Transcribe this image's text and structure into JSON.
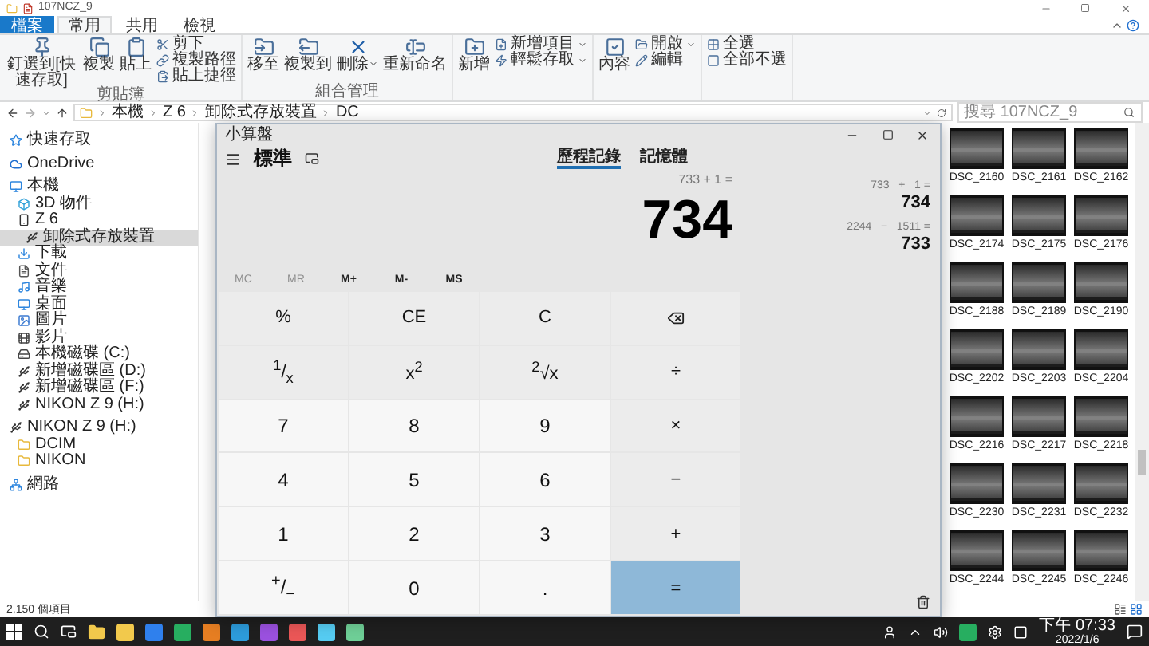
{
  "explorer": {
    "title": "107NCZ_9",
    "ribbon_tabs": [
      {
        "label": "檔案",
        "kind": "file",
        "selected": false
      },
      {
        "label": "常用",
        "kind": "tab",
        "selected": true
      },
      {
        "label": "共用",
        "kind": "tab",
        "selected": false
      },
      {
        "label": "檢視",
        "kind": "tab",
        "selected": false
      }
    ],
    "ribbon_groups": [
      {
        "label": "剪貼簿",
        "items": [
          {
            "kind": "large",
            "label": "釘選到[快速存取]"
          },
          {
            "kind": "large",
            "label": "複製"
          },
          {
            "kind": "large",
            "label": "貼上"
          },
          {
            "kind": "stack",
            "items": [
              {
                "label": "剪下"
              },
              {
                "label": "複製路徑"
              },
              {
                "label": "貼上捷徑"
              }
            ]
          }
        ]
      },
      {
        "label": "組合管理",
        "items": [
          {
            "kind": "large",
            "label": "移至"
          },
          {
            "kind": "large",
            "label": "複製到"
          },
          {
            "kind": "large",
            "label": "刪除",
            "dropdown": true
          },
          {
            "kind": "large",
            "label": "重新命名"
          }
        ]
      },
      {
        "items": [
          {
            "kind": "large",
            "label": "新增"
          },
          {
            "kind": "stack",
            "items": [
              {
                "label": "新增項目",
                "dropdown": true
              },
              {
                "label": "輕鬆存取",
                "dropdown": true
              }
            ]
          }
        ]
      },
      {
        "items": [
          {
            "kind": "large",
            "label": "內容"
          },
          {
            "kind": "stack",
            "items": [
              {
                "label": "開啟",
                "dropdown": true
              },
              {
                "label": "編輯"
              }
            ]
          }
        ]
      },
      {
        "items": [
          {
            "kind": "stack",
            "items": [
              {
                "label": "全選"
              },
              {
                "label": "全部不選"
              }
            ]
          }
        ]
      }
    ],
    "path": [
      "本機",
      "Z 6",
      "卸除式存放裝置",
      "DC"
    ],
    "search": {
      "placeholder": "搜尋 107NCZ_9"
    },
    "nav_tree": [
      {
        "label": "快速存取",
        "kind": "quick",
        "selected": false
      },
      {
        "label": "OneDrive",
        "kind": "cloud",
        "selected": false
      },
      {
        "label": "本機",
        "kind": "computer",
        "selected": false,
        "children": [
          {
            "label": "3D 物件",
            "kind": "objects",
            "selected": false
          },
          {
            "label": "Z 6",
            "kind": "device",
            "selected": false,
            "children": [
              {
                "label": "卸除式存放裝置",
                "kind": "removable",
                "selected": true
              }
            ]
          },
          {
            "label": "下載",
            "kind": "download",
            "selected": false
          },
          {
            "label": "文件",
            "kind": "document",
            "selected": false
          },
          {
            "label": "音樂",
            "kind": "music",
            "selected": false
          },
          {
            "label": "桌面",
            "kind": "desktop",
            "selected": false
          },
          {
            "label": "圖片",
            "kind": "pictures",
            "selected": false
          },
          {
            "label": "影片",
            "kind": "videos",
            "selected": false
          },
          {
            "label": "本機磁碟 (C:)",
            "kind": "disk",
            "selected": false
          },
          {
            "label": "新增磁碟區 (D:)",
            "kind": "removable",
            "selected": false
          },
          {
            "label": "新增磁碟區 (F:)",
            "kind": "removable",
            "selected": false
          },
          {
            "label": "NIKON Z 9  (H:)",
            "kind": "removable",
            "selected": false
          }
        ]
      },
      {
        "label": "NIKON Z 9  (H:)",
        "kind": "removable",
        "selected": false,
        "children": [
          {
            "label": "DCIM",
            "kind": "folder",
            "selected": false
          },
          {
            "label": "NIKON",
            "kind": "folder",
            "selected": false
          }
        ]
      },
      {
        "label": "網路",
        "kind": "network",
        "selected": false
      }
    ],
    "files": [
      "DSC_2160",
      "DSC_2161",
      "DSC_2162",
      "DSC_2174",
      "DSC_2175",
      "DSC_2176",
      "DSC_2188",
      "DSC_2189",
      "DSC_2190",
      "DSC_2202",
      "DSC_2203",
      "DSC_2204",
      "DSC_2216",
      "DSC_2217",
      "DSC_2218",
      "DSC_2230",
      "DSC_2231",
      "DSC_2232",
      "DSC_2244",
      "DSC_2245",
      "DSC_2246"
    ],
    "status": "2,150 個項目"
  },
  "calculator": {
    "title": "小算盤",
    "mode": "標準",
    "panel_tabs": [
      {
        "label": "歷程記錄",
        "selected": true
      },
      {
        "label": "記憶體",
        "selected": false
      }
    ],
    "expression": "733 + 1 =",
    "display": "734",
    "memory_buttons": [
      {
        "label": "MC",
        "disabled": true
      },
      {
        "label": "MR",
        "disabled": true
      },
      {
        "label": "M+",
        "disabled": false
      },
      {
        "label": "M-",
        "disabled": false
      },
      {
        "label": "MS",
        "disabled": false
      }
    ],
    "keys": [
      {
        "label": "%",
        "kind": "function"
      },
      {
        "label": "CE",
        "kind": "function"
      },
      {
        "label": "C",
        "kind": "function"
      },
      {
        "kind": "backspace"
      },
      {
        "label": "$^{1}$/$_{x}$",
        "kind": "function"
      },
      {
        "label": "x$^{2}$",
        "kind": "function"
      },
      {
        "label": "$^{2}$√x",
        "kind": "function"
      },
      {
        "label": "÷",
        "kind": "operator"
      },
      {
        "label": "7",
        "kind": "digit"
      },
      {
        "label": "8",
        "kind": "digit"
      },
      {
        "label": "9",
        "kind": "digit"
      },
      {
        "label": "×",
        "kind": "operator"
      },
      {
        "label": "4",
        "kind": "digit"
      },
      {
        "label": "5",
        "kind": "digit"
      },
      {
        "label": "6",
        "kind": "digit"
      },
      {
        "label": "−",
        "kind": "operator"
      },
      {
        "label": "1",
        "kind": "digit"
      },
      {
        "label": "2",
        "kind": "digit"
      },
      {
        "label": "3",
        "kind": "digit"
      },
      {
        "label": "+",
        "kind": "operator"
      },
      {
        "label": "$^{+}$/$_{−}$",
        "kind": "digit"
      },
      {
        "label": "0",
        "kind": "digit"
      },
      {
        "label": ".",
        "kind": "digit"
      },
      {
        "label": "=",
        "kind": "equals"
      }
    ],
    "history": [
      {
        "expression": "733   +   1 =",
        "result": "734"
      },
      {
        "expression": "2244   −   1511 =",
        "result": "733"
      }
    ]
  },
  "taskbar": {
    "time": "下午 07:33",
    "date": "2022/1/6"
  }
}
